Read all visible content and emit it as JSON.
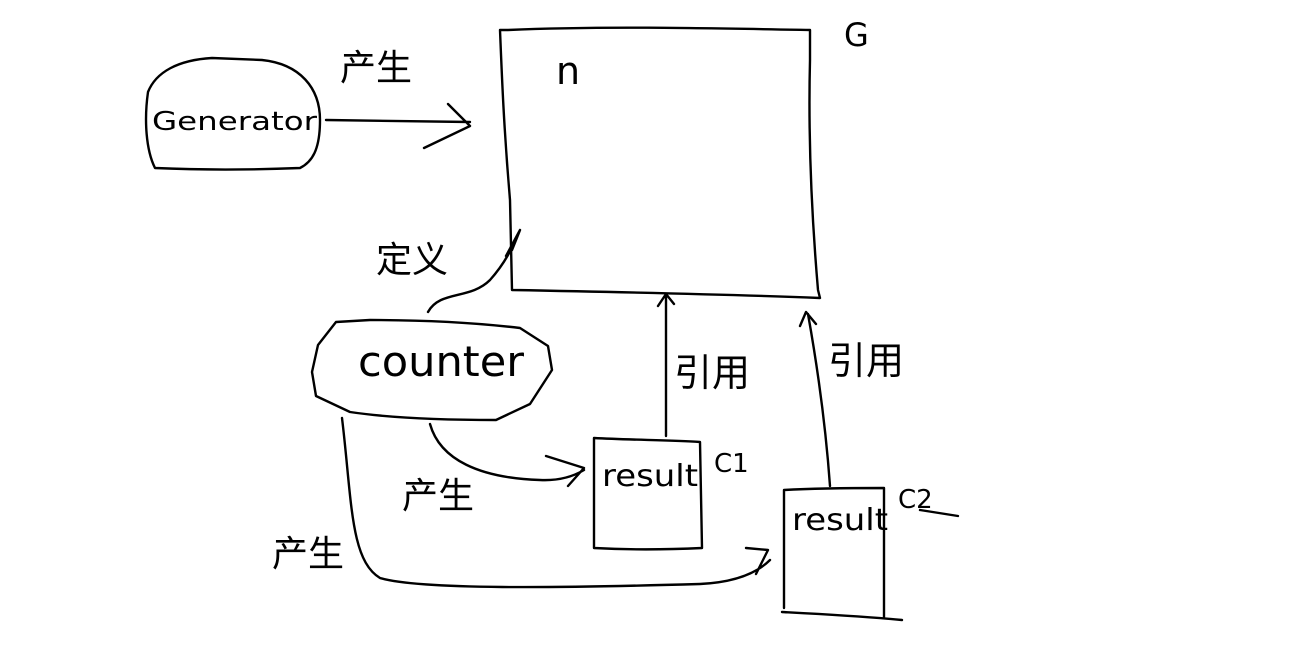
{
  "nodes": {
    "generator": "Generator",
    "g_box": "n",
    "g_label": "G",
    "counter": "counter",
    "result1": "result",
    "result1_label": "C1",
    "result2": "result",
    "result2_label": "C2"
  },
  "edges": {
    "generator_to_g": "产生",
    "counter_to_g": "定义",
    "counter_to_result1": "产生",
    "counter_to_result2": "产生",
    "result1_to_g": "引用",
    "result2_to_g": "引用"
  },
  "colors": {
    "ink": "#000000",
    "paper": "#ffffff"
  }
}
